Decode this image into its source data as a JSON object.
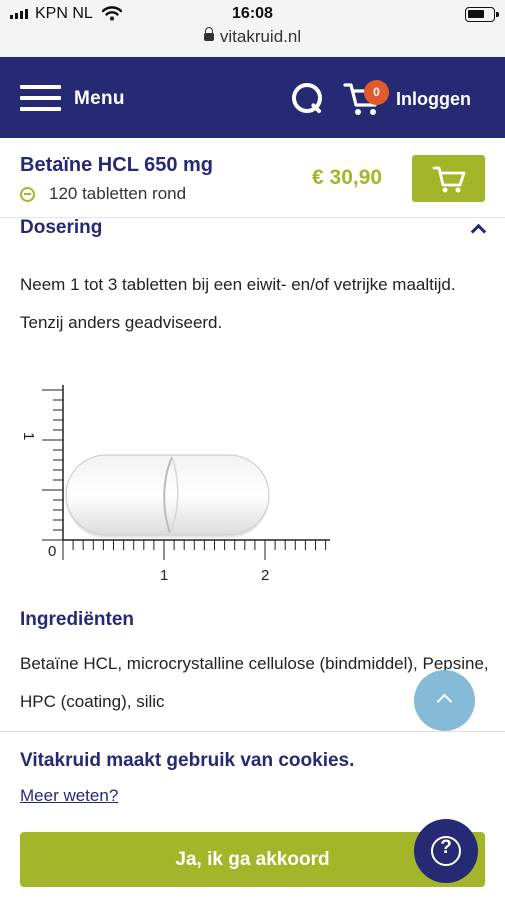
{
  "status_bar": {
    "carrier": "KPN NL",
    "time": "16:08",
    "url": "vitakruid.nl"
  },
  "header": {
    "menu_label": "Menu",
    "cart_count": "0",
    "login_label": "Inloggen"
  },
  "product": {
    "title": "Betaïne HCL 650 mg",
    "subtitle": "120 tabletten rond",
    "price": "€ 30,90"
  },
  "dosage": {
    "heading": "Dosering",
    "text": "Neem 1 tot 3 tabletten bij een eiwit- en/of vetrijke maaltijd. Tenzij anders geadviseerd."
  },
  "scale": {
    "y_label": "1",
    "x_labels": [
      "0",
      "1",
      "2"
    ]
  },
  "ingredients": {
    "heading": "Ingrediënten",
    "text": "Betaïne HCL, microcrystalline cellulose (bindmiddel), Pepsine, HPC (coating), silic"
  },
  "cookie": {
    "title": "Vitakruid maakt gebruik van cookies.",
    "link": "Meer weten?",
    "accept": "Ja, ik ga akkoord"
  },
  "icons": {
    "help": "?"
  },
  "colors": {
    "navy": "#262a75",
    "green": "#a3b62a",
    "badge": "#e05a2b",
    "scroll_button": "#7fb8d4"
  }
}
